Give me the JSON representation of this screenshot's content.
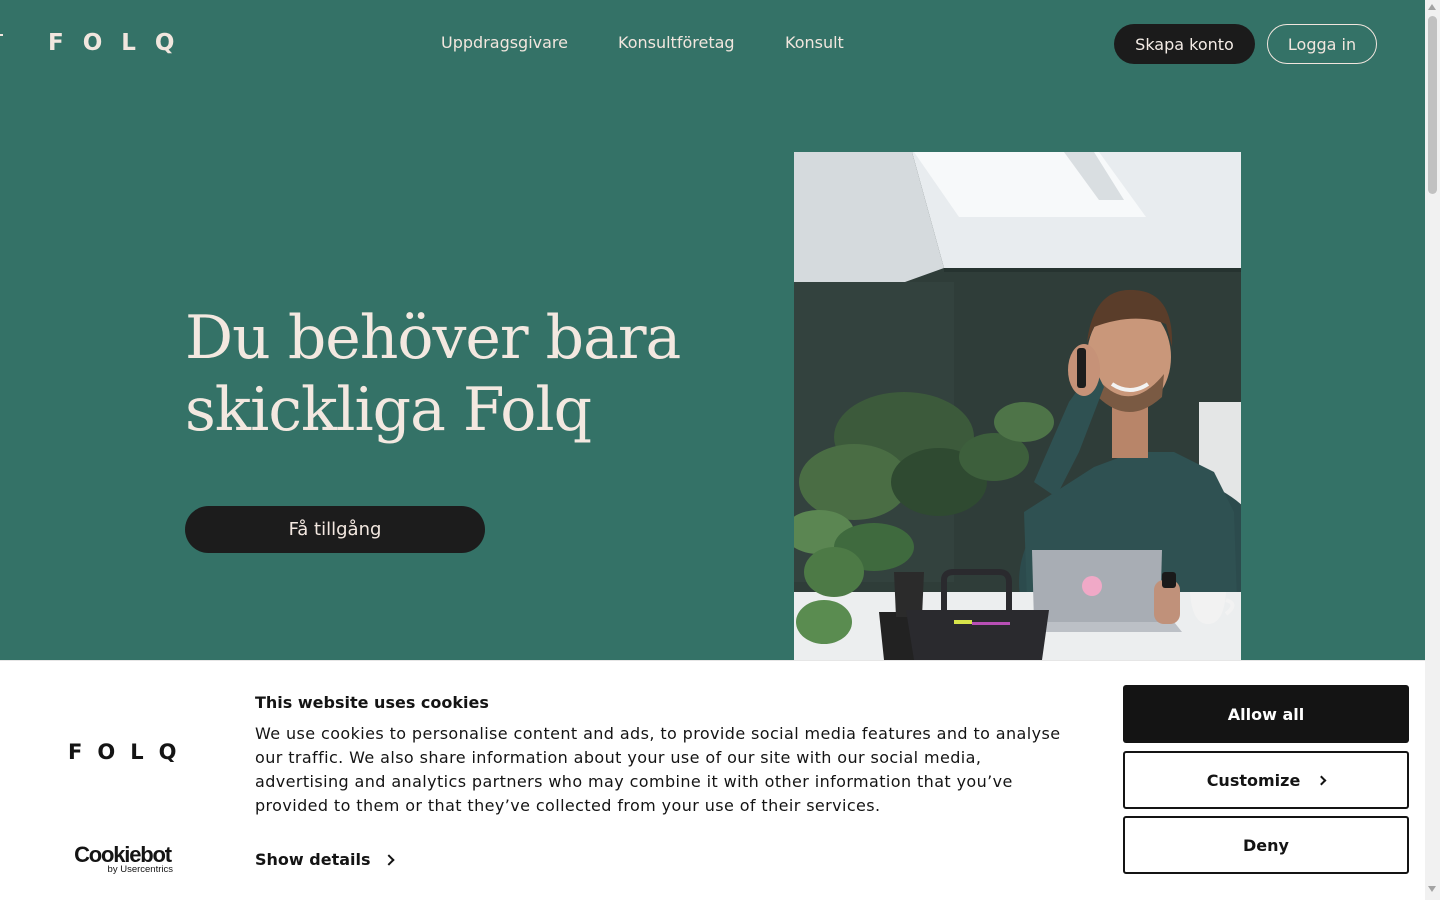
{
  "header": {
    "logo": "FOLQ",
    "nav": [
      {
        "label": "Uppdragsgivare"
      },
      {
        "label": "Konsultföretag"
      },
      {
        "label": "Konsult"
      }
    ],
    "create_account": "Skapa konto",
    "login": "Logga in"
  },
  "hero": {
    "title_line1": "Du behöver bara",
    "title_line2": "skickliga Folq",
    "cta": "Få tillgång",
    "image_label": "man-on-phone-at-laptop-photo"
  },
  "cookie_banner": {
    "logo": "FOLQ",
    "title": "This website uses cookies",
    "body": "We use cookies to personalise content and ads, to provide social media features and to analyse our traffic. We also share information about your use of our site with our social media, advertising and analytics partners who may combine it with other information that you’ve provided to them or that they’ve collected from your use of their services.",
    "show_details": "Show details",
    "allow_all": "Allow all",
    "customize": "Customize",
    "deny": "Deny",
    "provider_name": "Cookiebot",
    "provider_sub": "by Usercentrics"
  },
  "colors": {
    "brand_green": "#347267",
    "cream": "#f1e6de",
    "dark": "#1b1b1b"
  }
}
